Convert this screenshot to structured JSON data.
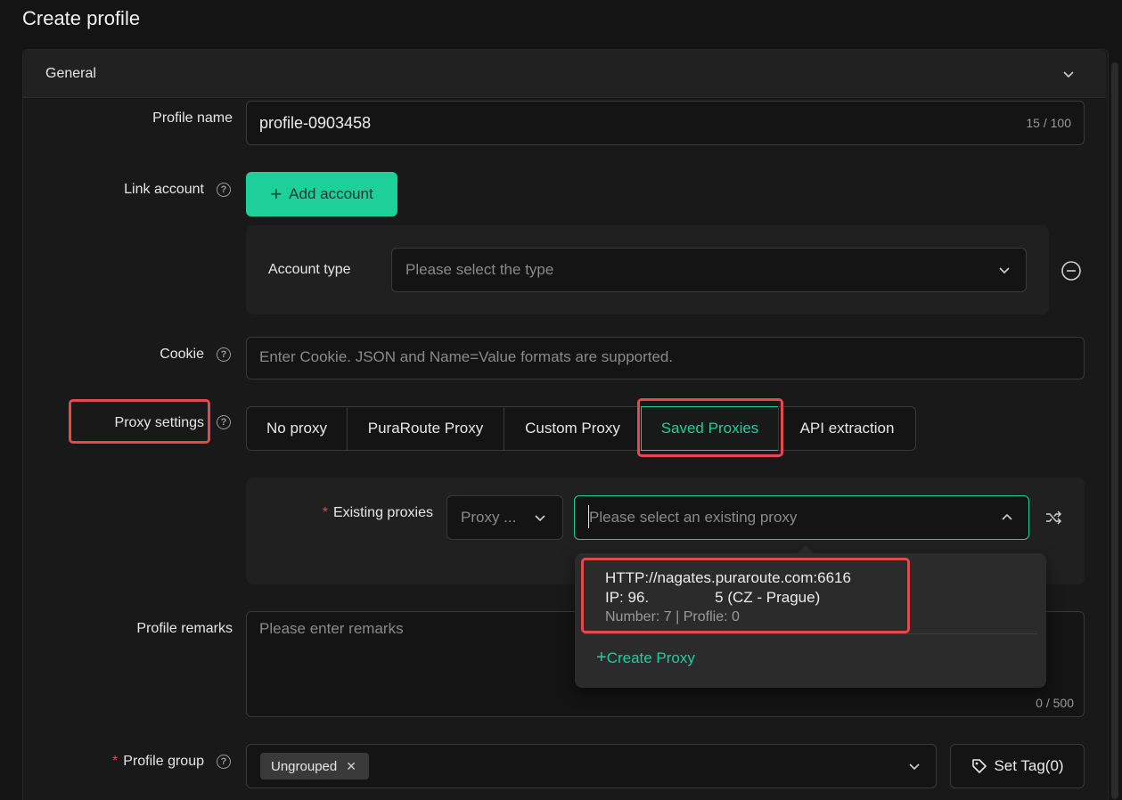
{
  "page": {
    "title": "Create profile"
  },
  "section": {
    "title": "General"
  },
  "profile_name": {
    "label": "Profile name",
    "value": "profile-0903458",
    "counter": "15 / 100"
  },
  "link_account": {
    "label": "Link account",
    "button": "Add account",
    "account_type_label": "Account type",
    "account_type_placeholder": "Please select the type"
  },
  "cookie": {
    "label": "Cookie",
    "placeholder": "Enter Cookie. JSON and Name=Value formats are supported."
  },
  "proxy": {
    "label": "Proxy settings",
    "tabs": [
      "No proxy",
      "PuraRoute Proxy",
      "Custom Proxy",
      "Saved Proxies",
      "API extraction"
    ],
    "active_tab": "Saved Proxies",
    "existing_label": "Existing proxies",
    "filter_value": "Proxy ...",
    "select_placeholder": "Please select an existing proxy",
    "options": [
      {
        "line1": "HTTP://nagates.puraroute.com:6616",
        "ip_prefix": "IP: 96.",
        "ip_suffix": "5 (CZ - Prague)",
        "stats": "Number: 7 | Proflie: 0"
      }
    ],
    "create_label": "Create Proxy"
  },
  "remarks": {
    "label": "Profile remarks",
    "placeholder": "Please enter remarks",
    "counter": "0 / 500"
  },
  "group": {
    "label": "Profile group",
    "tag": "Ungrouped",
    "set_tag": "Set Tag(0)"
  },
  "colors": {
    "accent": "#1fcf9a",
    "highlight": "#e5484d",
    "background": "#141414"
  }
}
